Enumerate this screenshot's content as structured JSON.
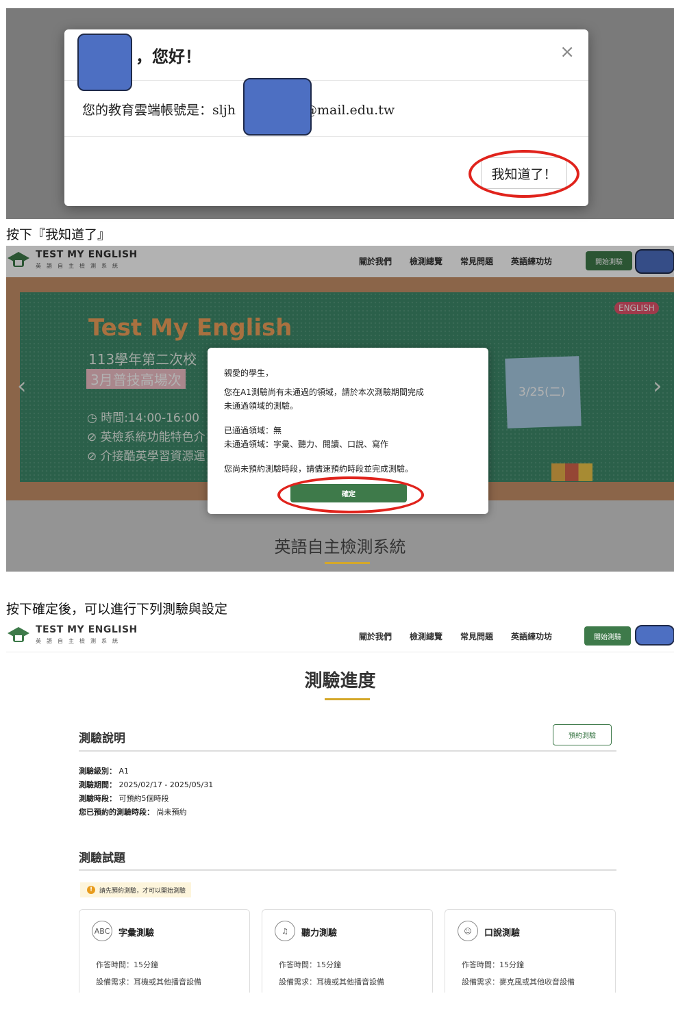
{
  "greeting_modal": {
    "greeting": "，您好！",
    "close_symbol": "×",
    "account_prefix": "您的教育雲端帳號是：sljh",
    "account_suffix": "@mail.edu.tw",
    "ok_label": "我知道了！"
  },
  "caption_1": "按下『我知道了』",
  "nav": {
    "logo_title": "TEST MY ENGLISH",
    "logo_subtitle": "英語自主檢測系統",
    "links": [
      "關於我們",
      "檢測總覽",
      "常見問題",
      "英語練功坊"
    ],
    "start_label": "開始測驗"
  },
  "home": {
    "banner_title": "Test My English",
    "banner_line1": "113學年第二次校",
    "banner_pink": "3月普技高場次",
    "banner_time": "◷ 時間:14:00-16:00",
    "banner_item1": "⊘ 英檢系統功能特色介",
    "banner_item2": "⊘ 介接酷英學習資源運",
    "note_date": "3/25(二)",
    "badge": "ENGLISH",
    "arrow_left": "‹",
    "arrow_right": "›",
    "heading": "英語自主檢測系統"
  },
  "notice_modal": {
    "salutation": "親愛的學生，",
    "line1": "您在A1測驗尚有未通過的領域，請於本次測驗期間完成",
    "line2": "未通過領域的測驗。",
    "passed": "已通過領域：無",
    "failed": "未通過領域：字彙、聽力、閱讀、口說、寫作",
    "reminder": "您尚未預約測驗時段，請儘速預約時段並完成測驗。",
    "ok_label": "確定"
  },
  "caption_2": "按下確定後，可以進行下列測驗與設定",
  "progress": {
    "title": "測驗進度",
    "section1": "測驗說明",
    "reserve_label": "預約測驗",
    "info": [
      {
        "label": "測驗級別：",
        "value": "A1"
      },
      {
        "label": "測驗期間：",
        "value": "2025/02/17 - 2025/05/31"
      },
      {
        "label": "測驗時段：",
        "value": "可預約5個時段"
      },
      {
        "label": "您已預約的測驗時段：",
        "value": "尚未預約"
      }
    ],
    "section2": "測驗試題",
    "warning": "請先預約測驗，才可以開始測驗",
    "cards": [
      {
        "icon": "ABC",
        "title": "字彙測驗",
        "time": "作答時間：15分鐘",
        "device": "設備需求：耳機或其他播音設備"
      },
      {
        "icon": "♫",
        "title": "聽力測驗",
        "time": "作答時間：15分鐘",
        "device": "設備需求：耳機或其他播音設備"
      },
      {
        "icon": "☺",
        "title": "口說測驗",
        "time": "作答時間：15分鐘",
        "device": "設備需求：麥克風或其他收音設備"
      }
    ]
  },
  "colors": {
    "brand_green": "#3e7a4a",
    "highlight_red": "#e0231c",
    "accent_gold": "#d4a82a",
    "redaction_blue": "#4d6fc2"
  }
}
